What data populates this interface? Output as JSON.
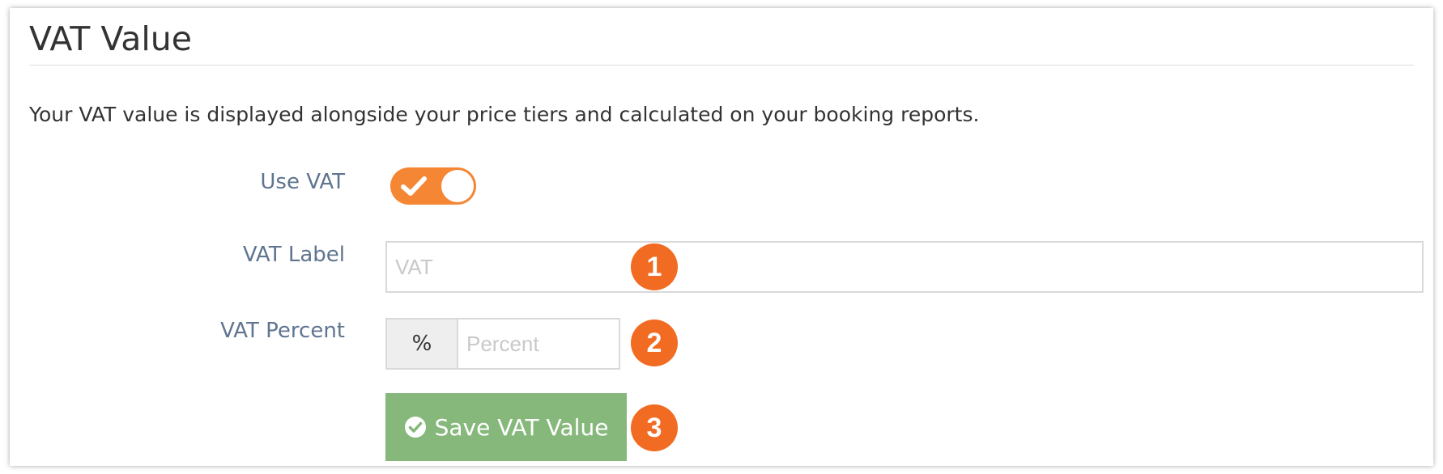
{
  "section": {
    "title": "VAT Value",
    "description": "Your VAT value is displayed alongside your price tiers and calculated on your booking reports."
  },
  "form": {
    "use_vat": {
      "label": "Use VAT",
      "enabled": true,
      "icon": "check-icon"
    },
    "vat_label": {
      "label": "VAT Label",
      "value": "",
      "placeholder": "VAT"
    },
    "vat_percent": {
      "label": "VAT Percent",
      "addon": "%",
      "value": "",
      "placeholder": "Percent"
    },
    "save_button": {
      "label": "Save VAT Value",
      "icon": "check-circle-icon"
    }
  },
  "annotations": {
    "badges": [
      "1",
      "2",
      "3"
    ]
  },
  "colors": {
    "toggle_on": "#f58634",
    "save_button": "#86b87c",
    "badge": "#f26b22",
    "label_text": "#5f7590"
  }
}
